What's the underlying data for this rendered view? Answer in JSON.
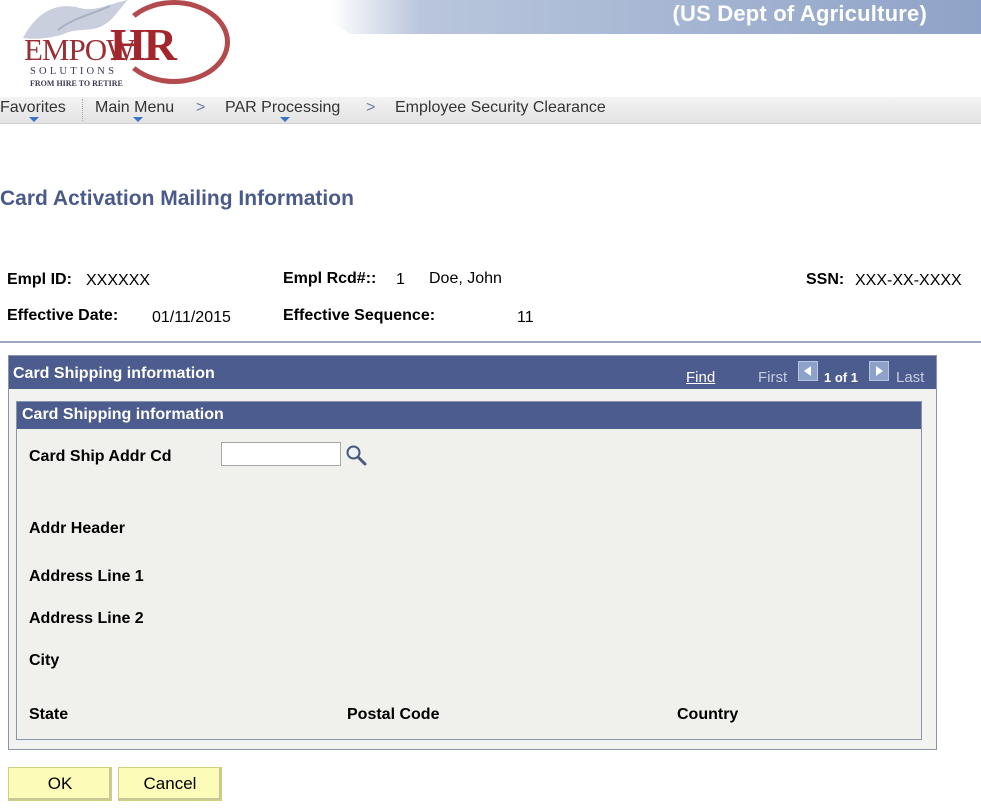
{
  "header": {
    "agency": "(US Dept of Agriculture)",
    "logo": {
      "brand_part1": "EMPOW",
      "brand_part2": "HR",
      "line2": "SOLUTIONS",
      "line3": "FROM HIRE TO RETIRE"
    }
  },
  "nav": {
    "favorites": "Favorites",
    "main_menu": "Main Menu",
    "par_processing": "PAR Processing",
    "employee_security": "Employee Security Clearance",
    "separator": ">"
  },
  "page": {
    "title": "Card Activation Mailing Information"
  },
  "employee": {
    "empl_id_label": "Empl ID:",
    "empl_id": "XXXXXX",
    "empl_rcd_label": "Empl Rcd#::",
    "empl_rcd": "1",
    "name": "Doe, John",
    "ssn_label": "SSN:",
    "ssn": "XXX-XX-XXXX",
    "effective_date_label": "Effective Date:",
    "effective_date": "01/11/2015",
    "effective_sequence_label": "Effective Sequence:",
    "effective_sequence": "11"
  },
  "panel": {
    "title": "Card Shipping information",
    "find": "Find",
    "first": "First",
    "count": "1 of 1",
    "last": "Last",
    "inner_title": "Card Shipping information",
    "fields": {
      "card_ship_addr_cd": "Card Ship Addr Cd",
      "card_ship_addr_cd_value": "",
      "addr_header": "Addr Header",
      "address_line_1": "Address Line 1",
      "address_line_2": "Address Line 2",
      "city": "City",
      "state": "State",
      "postal_code": "Postal Code",
      "country": "Country"
    }
  },
  "buttons": {
    "ok": "OK",
    "cancel": "Cancel"
  },
  "colors": {
    "panel_header": "#4d5c8f",
    "title_text": "#4a5a8a",
    "button_bg": "#fcfcb8",
    "brand_red": "#a3262c"
  }
}
